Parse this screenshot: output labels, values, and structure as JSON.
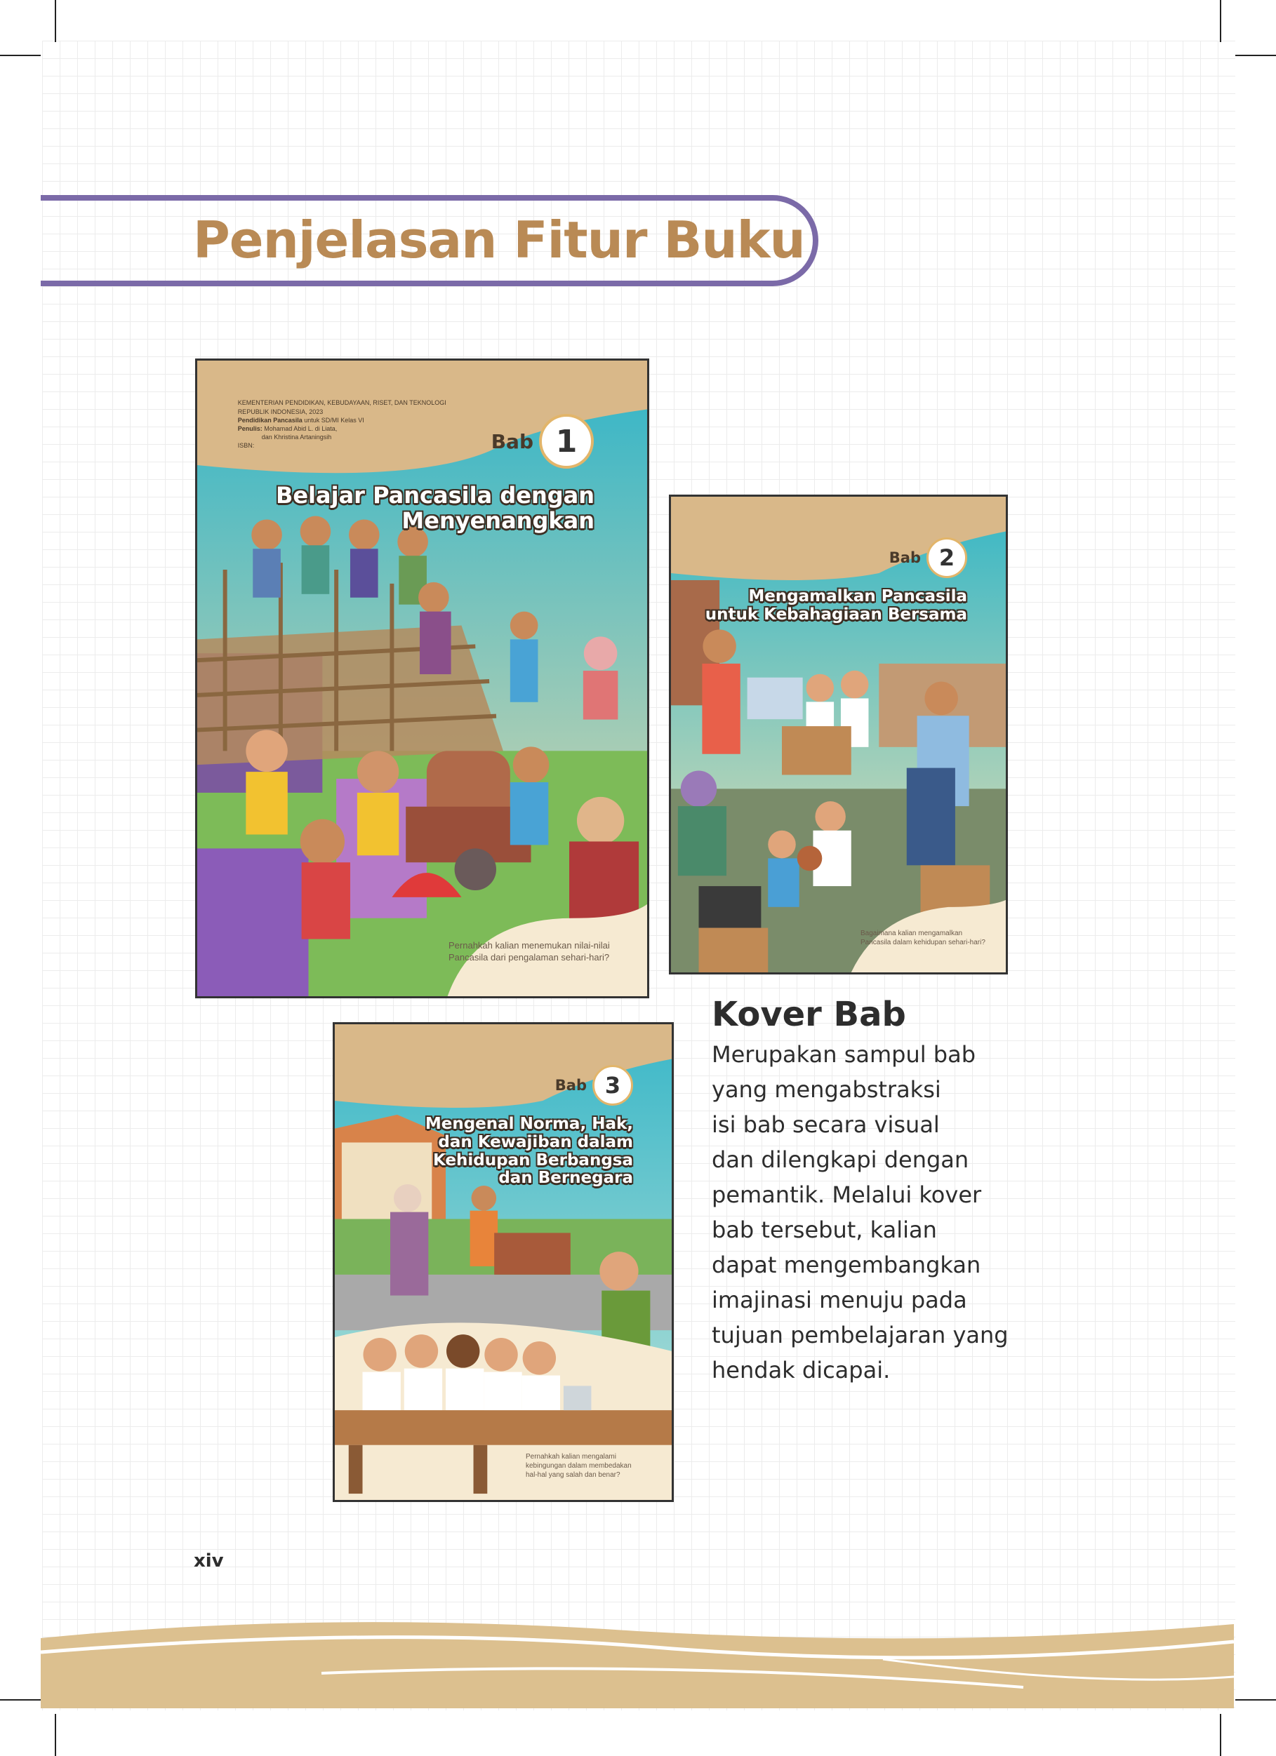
{
  "page": {
    "title": "Penjelasan Fitur Buku",
    "page_number": "xiv"
  },
  "colors": {
    "title_brown": "#b98a55",
    "accent_purple": "#7b6aa8",
    "footer_tan": "#dcc08f",
    "text_dark": "#2d2d2d"
  },
  "covers": [
    {
      "meta": {
        "ministry": "KEMENTERIAN PENDIDIKAN, KEBUDAYAAN, RISET, DAN TEKNOLOGI",
        "country_year": "REPUBLIK INDONESIA, 2023",
        "subject_label": "Pendidikan Pancasila",
        "subject_value": "untuk SD/MI Kelas VI",
        "author_label": "Penulis:",
        "author_value": "Mohamad Abid L. di Liata,",
        "author_value2": "dan Khristina Artaningsih",
        "isbn": "ISBN:"
      },
      "bab_label": "Bab",
      "bab_number": "1",
      "title_line1": "Belajar Pancasila dengan",
      "title_line2": "Menyenangkan",
      "question_line1": "Pernahkah kalian menemukan nilai-nilai",
      "question_line2": "Pancasila dari pengalaman sehari-hari?"
    },
    {
      "bab_label": "Bab",
      "bab_number": "2",
      "title_line1": "Mengamalkan Pancasila",
      "title_line2": "untuk Kebahagiaan Bersama",
      "question_line1": "Bagaimana kalian mengamalkan",
      "question_line2": "Pancasila dalam kehidupan sehari-hari?"
    },
    {
      "bab_label": "Bab",
      "bab_number": "3",
      "title_line1": "Mengenal Norma, Hak,",
      "title_line2": "dan Kewajiban dalam",
      "title_line3": "Kehidupan Berbangsa",
      "title_line4": "dan Bernegara",
      "question_line1": "Pernahkah kalian mengalami",
      "question_line2": "kebingungan dalam membedakan",
      "question_line3": "hal-hal yang salah dan benar?"
    }
  ],
  "kover": {
    "heading": "Kover Bab",
    "lines": [
      "Merupakan sampul bab",
      "yang mengabstraksi",
      "isi bab secara visual",
      "dan dilengkapi dengan",
      "pemantik. Melalui kover",
      "bab tersebut, kalian",
      "dapat mengembangkan",
      "imajinasi menuju pada",
      "tujuan pembelajaran yang",
      "hendak dicapai."
    ]
  }
}
